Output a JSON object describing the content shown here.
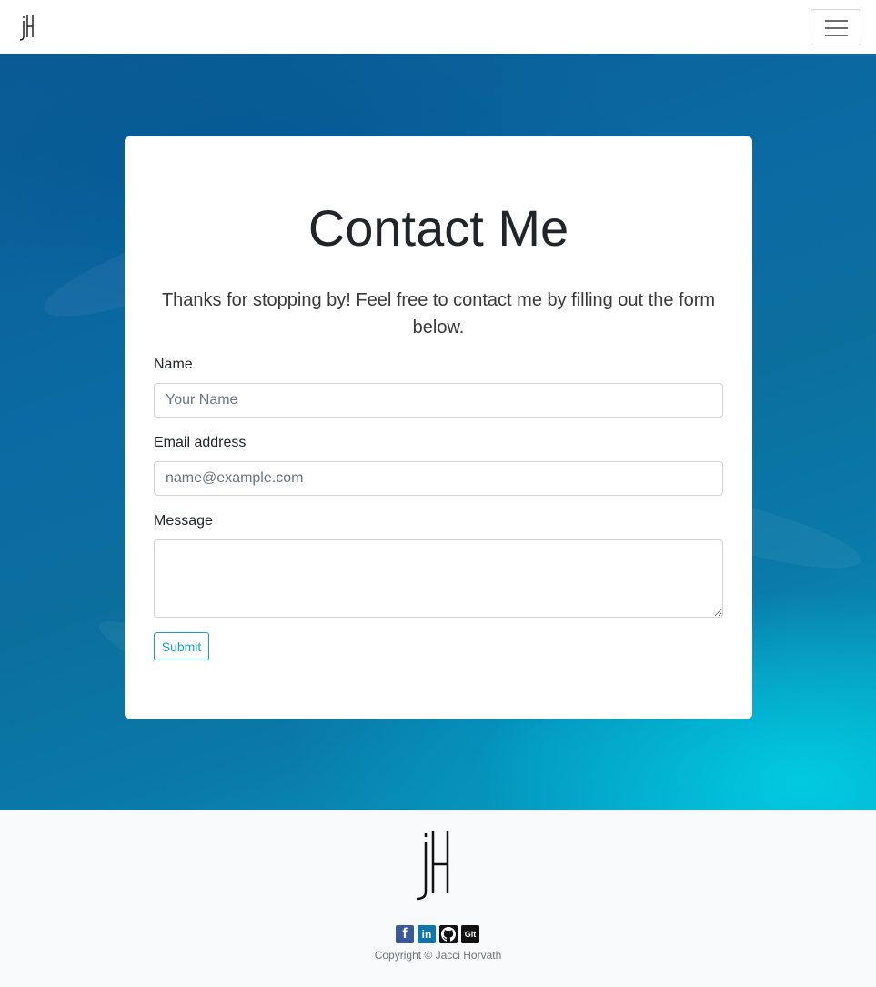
{
  "nav": {
    "logo_alt": "jH",
    "toggler_label": "Toggle navigation"
  },
  "contact": {
    "title": "Contact Me",
    "lead": "Thanks for stopping by! Feel free to contact me by filling out the form below.",
    "name_label": "Name",
    "name_placeholder": "Your Name",
    "email_label": "Email address",
    "email_placeholder": "name@example.com",
    "message_label": "Message",
    "message_value": "",
    "submit_label": "Submit"
  },
  "footer": {
    "socials": [
      {
        "name": "facebook",
        "glyph": "f"
      },
      {
        "name": "linkedin",
        "glyph": "in"
      },
      {
        "name": "github",
        "glyph": ""
      },
      {
        "name": "git",
        "glyph": "Git"
      }
    ],
    "copyright": "Copyright © Jacci Horvath"
  },
  "colors": {
    "accent": "#17a2b8",
    "facebook": "#3b5998",
    "linkedin": "#0e76a8",
    "footer_bg": "#f8f9fa"
  }
}
